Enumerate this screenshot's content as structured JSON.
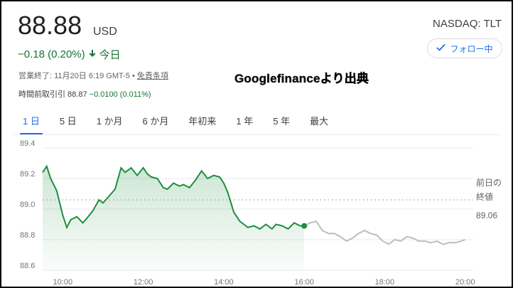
{
  "quote": {
    "price": "88.88",
    "currency": "USD",
    "change": "−0.18 (0.20%)",
    "change_period": "今日",
    "exchange_ticker": "NASDAQ: TLT",
    "follow_label": "フォロー中",
    "close_info": "営業終了: 11月20日 6:19 GMT-5 • ",
    "disclaimer": "免責条項",
    "premarket_label": "時間前取引引 88.87",
    "premarket_change": "−0.0100 (0.011%)"
  },
  "watermark": "Googlefinanceより出典",
  "tabs": [
    "1 日",
    "5 日",
    "1 か月",
    "6 か月",
    "年初来",
    "1 年",
    "5 年",
    "最大"
  ],
  "active_tab": 0,
  "prev_close": {
    "label_line1": "前日の",
    "label_line2": "終値",
    "value": "89.06"
  },
  "colors": {
    "up_green": "#1e8e3e",
    "after_hours_gray": "#bdbdbd",
    "accent_blue": "#1a73e8"
  },
  "chart_data": {
    "type": "line",
    "y_ticks": [
      "89.4",
      "89.2",
      "89.0",
      "88.8",
      "88.6"
    ],
    "x_ticks": [
      "10:00",
      "12:00",
      "14:00",
      "16:00",
      "18:00",
      "20:00"
    ],
    "ylim": [
      88.6,
      89.4
    ],
    "xlim": [
      9.5,
      20.2
    ],
    "reference_line": 89.06,
    "series": [
      {
        "x": [
          9.5,
          9.6,
          9.7,
          9.85,
          10.0,
          10.1,
          10.2,
          10.35,
          10.5,
          10.6,
          10.75,
          10.9,
          11.0,
          11.1,
          11.2,
          11.3,
          11.45,
          11.55,
          11.7,
          11.85,
          12.0,
          12.1,
          12.2,
          12.35,
          12.5,
          12.6,
          12.75,
          12.9,
          13.0,
          13.15,
          13.3,
          13.45,
          13.6,
          13.75,
          13.9,
          14.0,
          14.1,
          14.25,
          14.4,
          14.5,
          14.6,
          14.75,
          14.9,
          15.05,
          15.2,
          15.3,
          15.45,
          15.6,
          15.75,
          15.9,
          16.0
        ],
        "y": [
          89.24,
          89.28,
          89.2,
          89.12,
          88.96,
          88.88,
          88.93,
          88.95,
          88.91,
          88.94,
          88.99,
          89.06,
          89.04,
          89.07,
          89.1,
          89.13,
          89.27,
          89.24,
          89.27,
          89.22,
          89.27,
          89.23,
          89.21,
          89.2,
          89.14,
          89.13,
          89.17,
          89.15,
          89.16,
          89.14,
          89.19,
          89.25,
          89.2,
          89.22,
          89.21,
          89.17,
          89.11,
          88.98,
          88.92,
          88.9,
          88.88,
          88.89,
          88.87,
          88.9,
          88.87,
          88.9,
          88.89,
          88.87,
          88.91,
          88.89,
          88.89
        ]
      },
      {
        "x": [
          16.0,
          16.15,
          16.3,
          16.45,
          16.6,
          16.75,
          16.9,
          17.05,
          17.2,
          17.35,
          17.5,
          17.65,
          17.8,
          17.95,
          18.1,
          18.25,
          18.4,
          18.55,
          18.7,
          18.85,
          19.0,
          19.15,
          19.3,
          19.45,
          19.6,
          19.75,
          19.9,
          20.0
        ],
        "y": [
          88.89,
          88.91,
          88.92,
          88.86,
          88.84,
          88.84,
          88.82,
          88.79,
          88.81,
          88.84,
          88.86,
          88.84,
          88.83,
          88.79,
          88.77,
          88.8,
          88.79,
          88.82,
          88.81,
          88.79,
          88.79,
          88.78,
          88.79,
          88.77,
          88.78,
          88.78,
          88.79,
          88.8
        ]
      }
    ],
    "grid": "horizontal dotted"
  }
}
